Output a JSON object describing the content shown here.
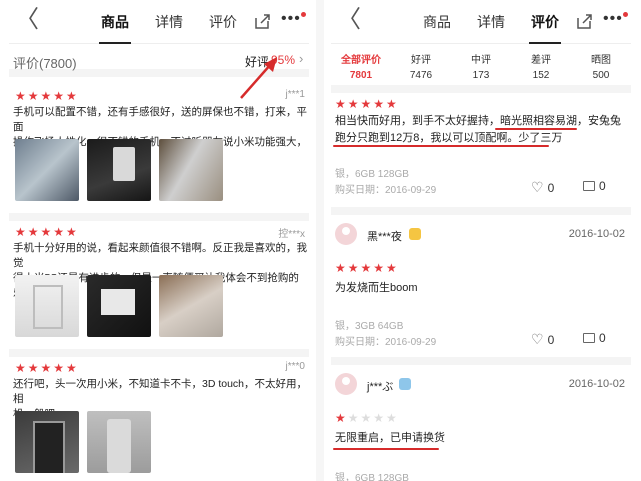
{
  "left": {
    "nav": {
      "back": "〈",
      "tabs": [
        "商品",
        "详情",
        "评价"
      ],
      "active_tab": 0,
      "more": "•••"
    },
    "summary": {
      "count_label": "评价(7800)",
      "good_label": "好评",
      "good_pct": "95%",
      "chevron": "›"
    },
    "reviews": [
      {
        "user": "j***1",
        "stars": 5,
        "text_lines": [
          "手机可以配置不错，还有手感很好，送的屏保也不错，打来，平面",
          "操作飞扬人性化，很不错的手机，不过听朋友说小米功能强大，"
        ]
      },
      {
        "user": "控***x",
        "stars": 5,
        "text_lines": [
          "手机十分好用的说，看起来颜值很不错啊。反正我是喜欢的，我觉",
          "得小米5S还是有进步的，但是一直随便买让我体会不到抢购的乐..."
        ]
      },
      {
        "user": "j***0",
        "stars": 5,
        "text_lines": [
          "还行吧，头一次用小米，不知道卡不卡，3D touch，不太好用，相",
          "机一般吧"
        ]
      }
    ]
  },
  "right": {
    "nav": {
      "back": "〈",
      "tabs": [
        "商品",
        "详情",
        "评价"
      ],
      "active_tab": 2,
      "more": "•••"
    },
    "filters": [
      {
        "label": "全部评价",
        "count": "7801"
      },
      {
        "label": "好评",
        "count": "7476"
      },
      {
        "label": "中评",
        "count": "173"
      },
      {
        "label": "差评",
        "count": "152"
      },
      {
        "label": "晒图",
        "count": "500"
      }
    ],
    "reviews": [
      {
        "stars": 5,
        "text_lines": [
          "相当快而好用，到手不太好握持，暗光照相容易湖，安兔兔",
          "跑分只跑到12万8，我以可以顶配啊。少了三万"
        ],
        "spec": "银，6GB 128GB",
        "date": "购买日期：2016-09-29",
        "likes": "0",
        "comments": "0"
      },
      {
        "user": "黑***夜",
        "review_date": "2016-10-02",
        "stars": 5,
        "text_lines": [
          "为发烧而生boom"
        ],
        "spec": "银，3GB 64GB",
        "date": "购买日期：2016-09-29",
        "likes": "0",
        "comments": "0"
      },
      {
        "user": "j***ぶ",
        "review_date": "2016-10-02",
        "stars": 1,
        "text_lines": [
          "无限重启，已申请换货"
        ],
        "spec": "银，6GB 128GB"
      }
    ]
  },
  "colors": {
    "accent": "#e4393c",
    "annotation": "#d62b2b"
  }
}
